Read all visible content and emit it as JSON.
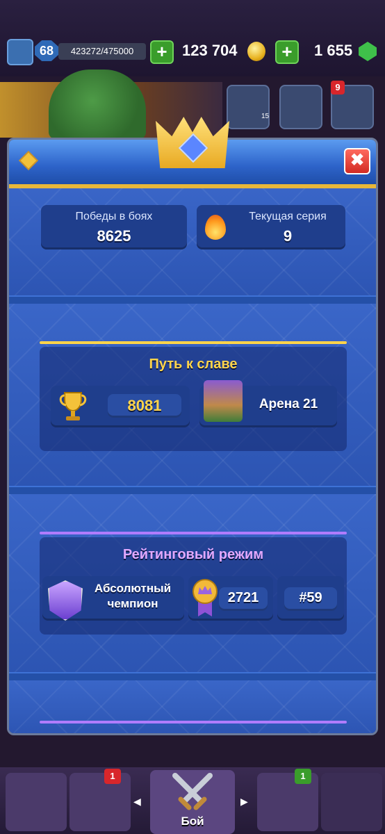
{
  "topbar": {
    "level": "68",
    "xp": "423272/475000",
    "plus": "+",
    "gold": "123 704",
    "gems": "1 655",
    "friends_count": "15",
    "menu_badge": "9"
  },
  "modal": {
    "close_label": "✖",
    "stats": {
      "wins_label": "Победы в боях",
      "wins_value": "8625",
      "streak_label": "Текущая серия",
      "streak_value": "9"
    },
    "path_of_legends": {
      "title": "Путь к славе",
      "trophies": "8081",
      "arena": "Арена 21"
    },
    "ranked": {
      "title": "Рейтинговый режим",
      "league_line1": "Абсолютный",
      "league_line2": "чемпион",
      "rating": "2721",
      "rank": "#59"
    }
  },
  "bottom_nav": {
    "cards_badge": "1",
    "clan_badge": "1",
    "battle_label": "Бой",
    "left_arrow": "◀",
    "right_arrow": "▶"
  },
  "colors": {
    "gold_accent": "#ffd44a",
    "purple_accent": "#b07cff",
    "close_red": "#d22b23"
  }
}
